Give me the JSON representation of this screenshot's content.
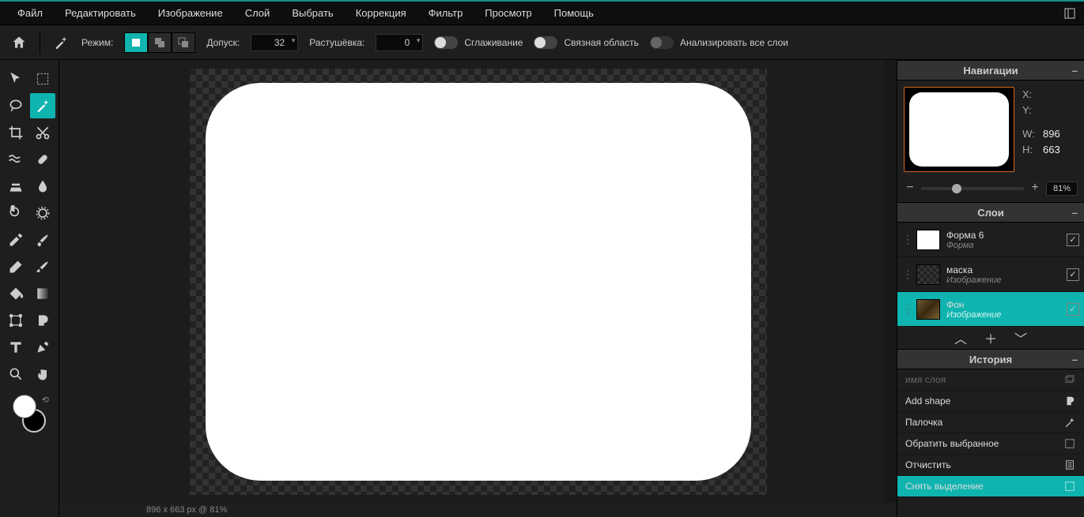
{
  "menu": [
    "Файл",
    "Редактировать",
    "Изображение",
    "Слой",
    "Выбрать",
    "Коррекция",
    "Фильтр",
    "Просмотр",
    "Помощь"
  ],
  "optbar": {
    "mode_label": "Режим:",
    "tolerance_label": "Допуск:",
    "tolerance_value": "32",
    "feather_label": "Растушёвка:",
    "feather_value": "0",
    "antialias_label": "Сглаживание",
    "contiguous_label": "Связная область",
    "alllayers_label": "Анализировать все слои"
  },
  "status_text": "896 x 663 px @ 81%",
  "panels": {
    "navigation_title": "Навигации",
    "layers_title": "Слои",
    "history_title": "История"
  },
  "nav": {
    "X_lbl": "X:",
    "Y_lbl": "Y:",
    "W_lbl": "W:",
    "H_lbl": "H:",
    "W": "896",
    "H": "663",
    "zoom": "81%"
  },
  "layers": [
    {
      "name": "Форма 6",
      "sub": "Форма",
      "thumb": "white",
      "selected": false
    },
    {
      "name": "маска",
      "sub": "Изображение",
      "thumb": "checker",
      "selected": false
    },
    {
      "name": "Фон",
      "sub": "Изображение",
      "thumb": "img",
      "selected": true
    }
  ],
  "history": [
    {
      "label": "имя слоя",
      "icon": "layer",
      "cut": true,
      "selected": false
    },
    {
      "label": "Add shape",
      "icon": "shape",
      "cut": false,
      "selected": false
    },
    {
      "label": "Палочка",
      "icon": "wand",
      "cut": false,
      "selected": false
    },
    {
      "label": "Обратить выбранное",
      "icon": "select",
      "cut": false,
      "selected": false
    },
    {
      "label": "Отчистить",
      "icon": "clear",
      "cut": false,
      "selected": false
    },
    {
      "label": "Снять выделение",
      "icon": "deselect",
      "cut": false,
      "selected": true
    }
  ]
}
